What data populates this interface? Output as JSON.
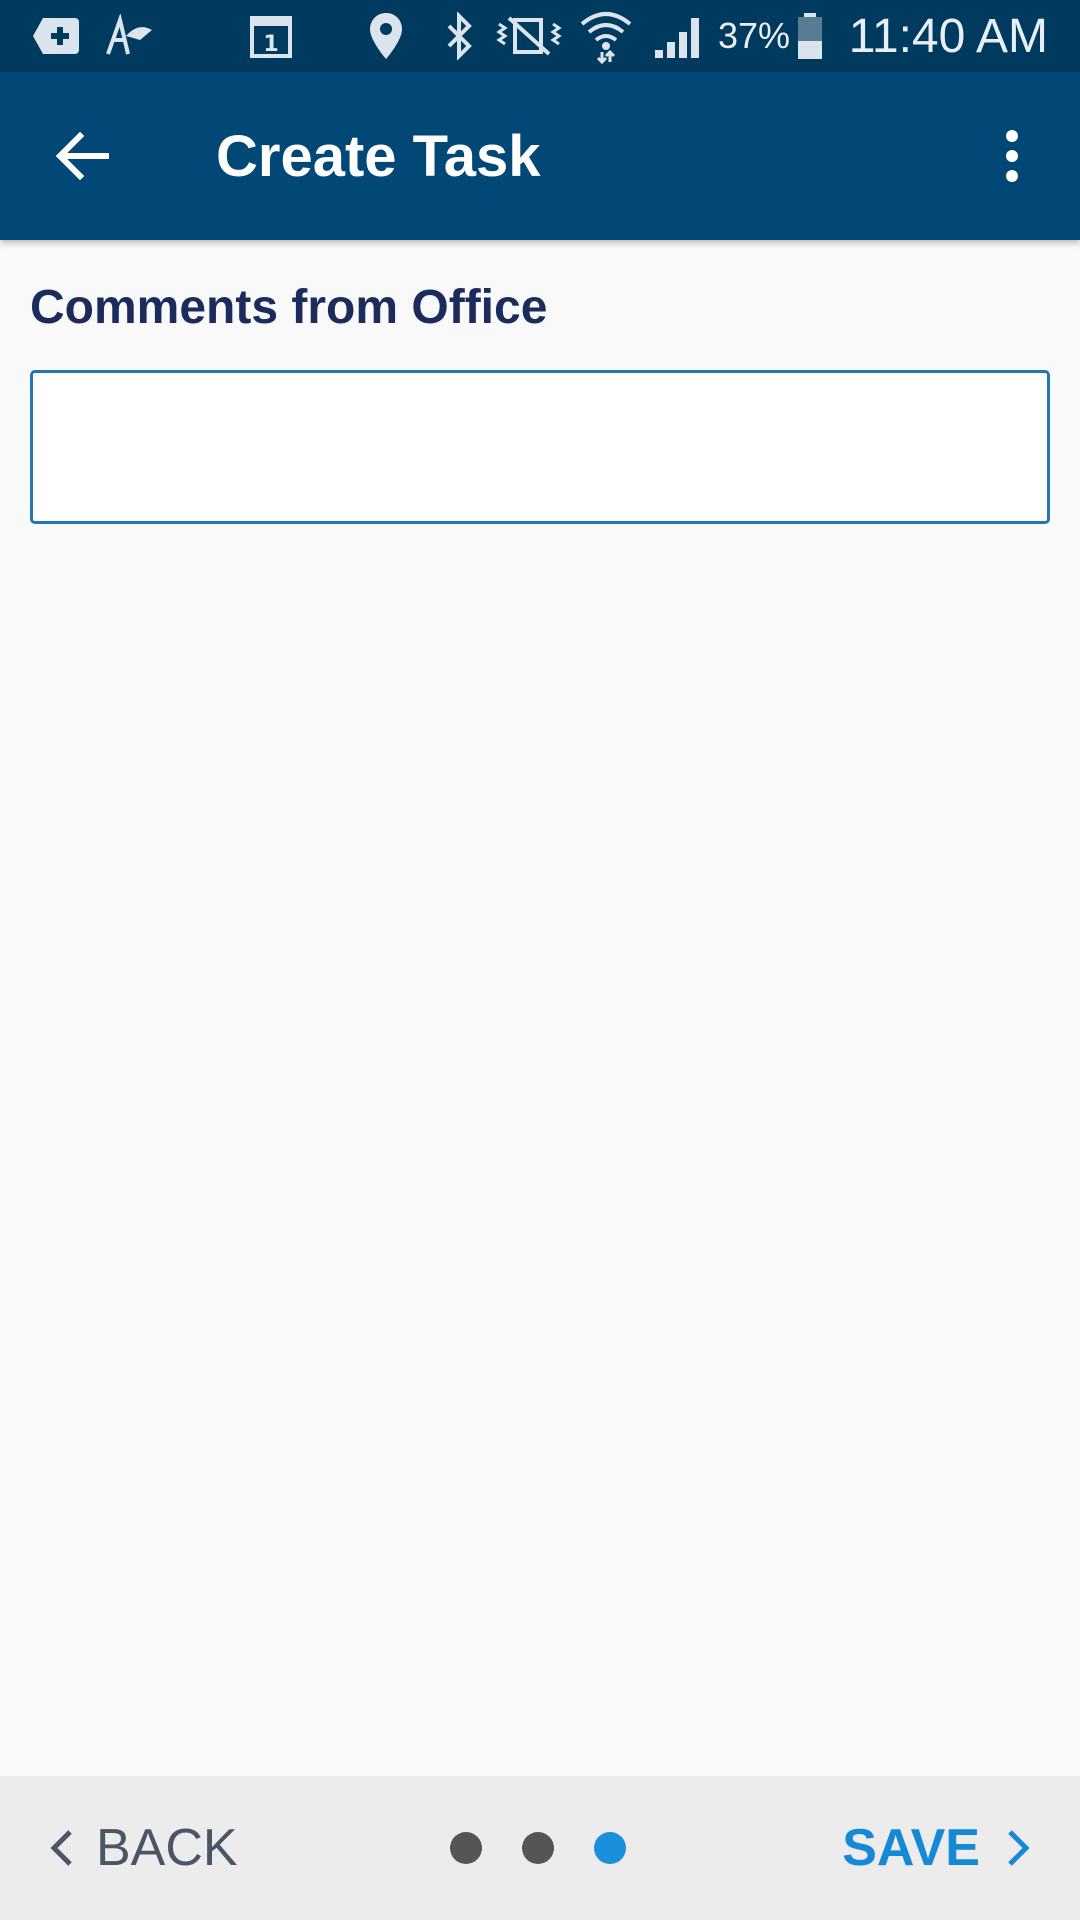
{
  "status_bar": {
    "icons": [
      "add-photo-icon",
      "pen-icon",
      "calendar-icon",
      "location-icon",
      "bluetooth-icon",
      "vibrate-icon",
      "wifi-icon",
      "signal-icon",
      "battery-icon"
    ],
    "calendar_day": "1",
    "battery_percent": "37%",
    "time": "11:40 AM",
    "background_color": "#013a5f"
  },
  "app_bar": {
    "title": "Create Task",
    "background_color": "#014877"
  },
  "form": {
    "comments_label": "Comments from Office",
    "comments_value": "",
    "comments_placeholder": ""
  },
  "bottom_nav": {
    "back_label": "BACK",
    "save_label": "SAVE",
    "page_count": 3,
    "current_page": 3,
    "accent_color": "#1588d6"
  }
}
